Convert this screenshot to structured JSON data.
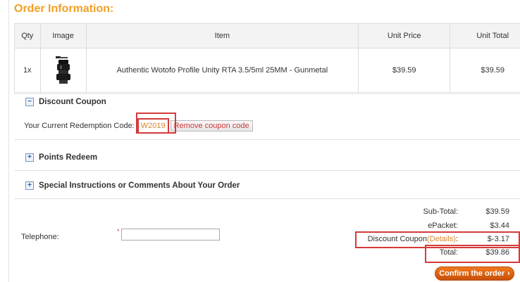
{
  "page": {
    "title": "Order Information:"
  },
  "order_table": {
    "headers": {
      "qty": "Qty",
      "image": "Image",
      "item": "Item",
      "unit_price": "Unit Price",
      "unit_total": "Unit Total"
    },
    "rows": [
      {
        "qty": "1x",
        "item": "Authentic Wotofo Profile Unity RTA 3.5/5ml 25MM - Gunmetal",
        "unit_price": "$39.59",
        "unit_total": "$39.59"
      }
    ]
  },
  "discount_coupon": {
    "title": "Discount Coupon",
    "toggle": "−",
    "label": "Your Current Redemption Code:",
    "code": "W2019",
    "remove_label": "Remove coupon code"
  },
  "points_redeem": {
    "title": "Points Redeem",
    "toggle": "+"
  },
  "special_instructions": {
    "title": "Special Instructions or Comments About Your Order",
    "toggle": "+"
  },
  "telephone": {
    "label": "Telephone:",
    "required_mark": "*",
    "value": ""
  },
  "summary": {
    "subtotal_label": "Sub-Total:",
    "subtotal_value": "$39.59",
    "shipping_label": "ePacket:",
    "shipping_value": "$3.44",
    "discount_label": "Discount Coupon",
    "discount_details": "(Details)",
    "discount_colon": ":",
    "discount_value": "$-3.17",
    "total_label": "Total:",
    "total_value": "$39.86"
  },
  "confirm": {
    "label": "Confirm the order",
    "arrow": "›"
  },
  "colors": {
    "title": "#f0a025",
    "highlight": "#d43a3a",
    "confirm": "#e0661a",
    "coupon_code": "#e0852a"
  }
}
